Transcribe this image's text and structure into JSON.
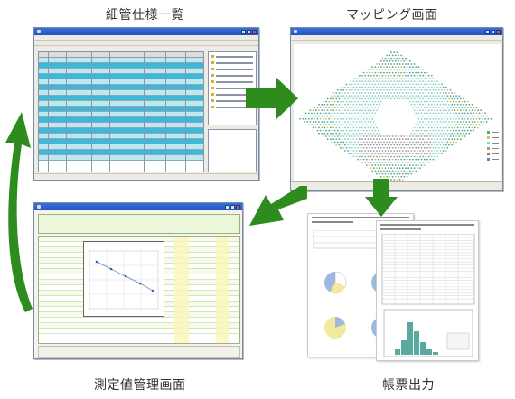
{
  "captions": {
    "spec_list": "細管仕様一覧",
    "mapping": "マッピング画面",
    "measurement": "測定値管理画面",
    "report": "帳票出力"
  },
  "colors": {
    "arrow_green": "#2e8b1e",
    "selected_row": "#3fb7d6",
    "row_fill": "#bfe7ef",
    "titlebar": "#2454c0"
  },
  "icons": [
    "right-arrow-icon",
    "down-arrow-icon",
    "down-left-arrow-icon",
    "curved-up-arrow-icon"
  ]
}
